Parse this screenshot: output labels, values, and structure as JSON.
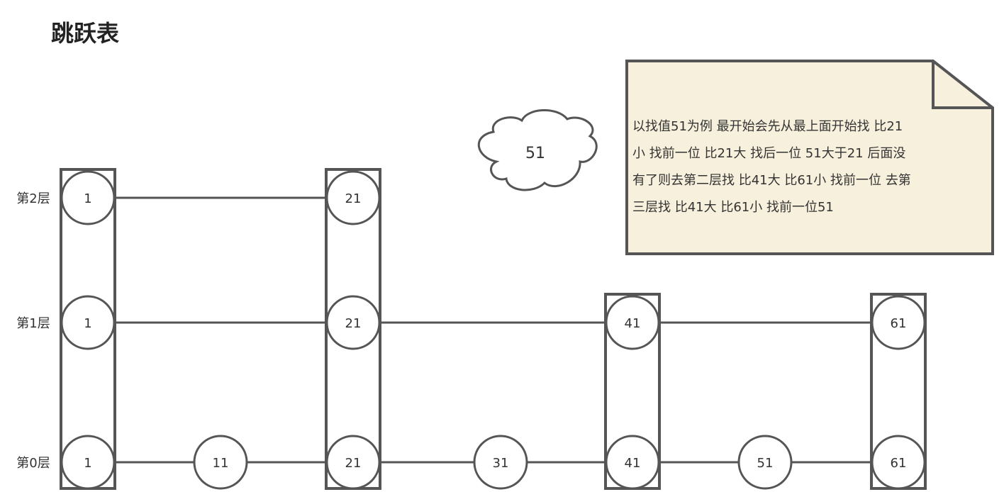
{
  "title": "跳跃表",
  "layers": [
    {
      "label": "第2层",
      "nodes": [
        "1",
        "21"
      ]
    },
    {
      "label": "第1层",
      "nodes": [
        "1",
        "21",
        "41",
        "61"
      ]
    },
    {
      "label": "第0层",
      "nodes": [
        "1",
        "11",
        "21",
        "31",
        "41",
        "51",
        "61"
      ]
    }
  ],
  "search_value": "51",
  "note": {
    "lines": [
      "以找值51为例 最开始会先从最上面开始找 比21",
      "小 找前一位 比21大 找后一位 51大于21 后面没",
      "有了则去第二层找 比41大 比61小 找前一位 去第",
      "三层找 比41大 比61小 找前一位51"
    ]
  },
  "colors": {
    "stroke": "#555555",
    "note_fill": "#f7f0dc"
  }
}
